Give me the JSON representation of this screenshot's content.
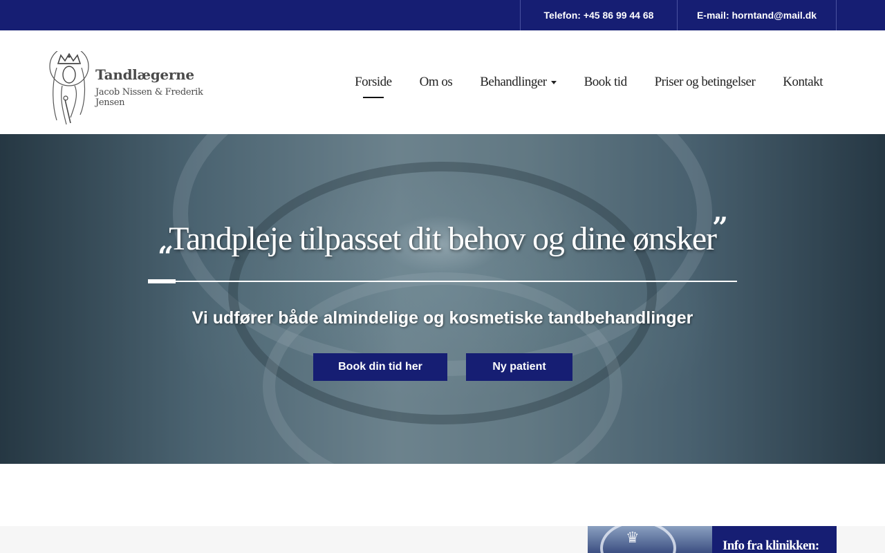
{
  "topbar": {
    "phone": "Telefon: +45 86 99 44 68",
    "email": "E-mail: horntand@mail.dk"
  },
  "logo": {
    "title": "Tandlægerne",
    "subtitle": "Jacob Nissen & Frederik Jensen"
  },
  "nav": {
    "items": [
      {
        "label": "Forside",
        "active": true
      },
      {
        "label": "Om os"
      },
      {
        "label": "Behandlinger",
        "dropdown": true
      },
      {
        "label": "Book tid"
      },
      {
        "label": "Priser og betingelser"
      },
      {
        "label": "Kontakt"
      }
    ]
  },
  "hero": {
    "quote": "Tandpleje tilpasset dit behov og dine ønsker",
    "subtitle": "Vi udfører både almindelige og kosmetiske tandbehandlinger",
    "buttons": {
      "book": "Book din tid her",
      "new_patient": "Ny patient"
    }
  },
  "info": {
    "title": "Info fra klinikken:"
  },
  "colors": {
    "brand": "#161e73"
  }
}
